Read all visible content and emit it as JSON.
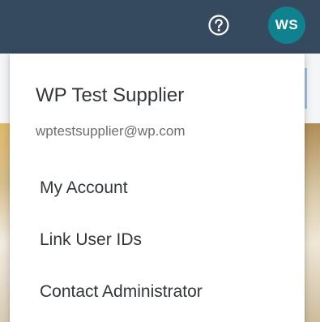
{
  "shellbar": {
    "help_icon": "help-circle-icon",
    "avatar_initials": "WS",
    "colors": {
      "bar": "#354a5f",
      "avatar": "#0f828f"
    }
  },
  "user_menu": {
    "name": "WP Test Supplier",
    "email": "wptestsupplier@wp.com",
    "items": [
      {
        "label": "My Account"
      },
      {
        "label": "Link User IDs"
      },
      {
        "label": "Contact Administrator"
      }
    ]
  }
}
